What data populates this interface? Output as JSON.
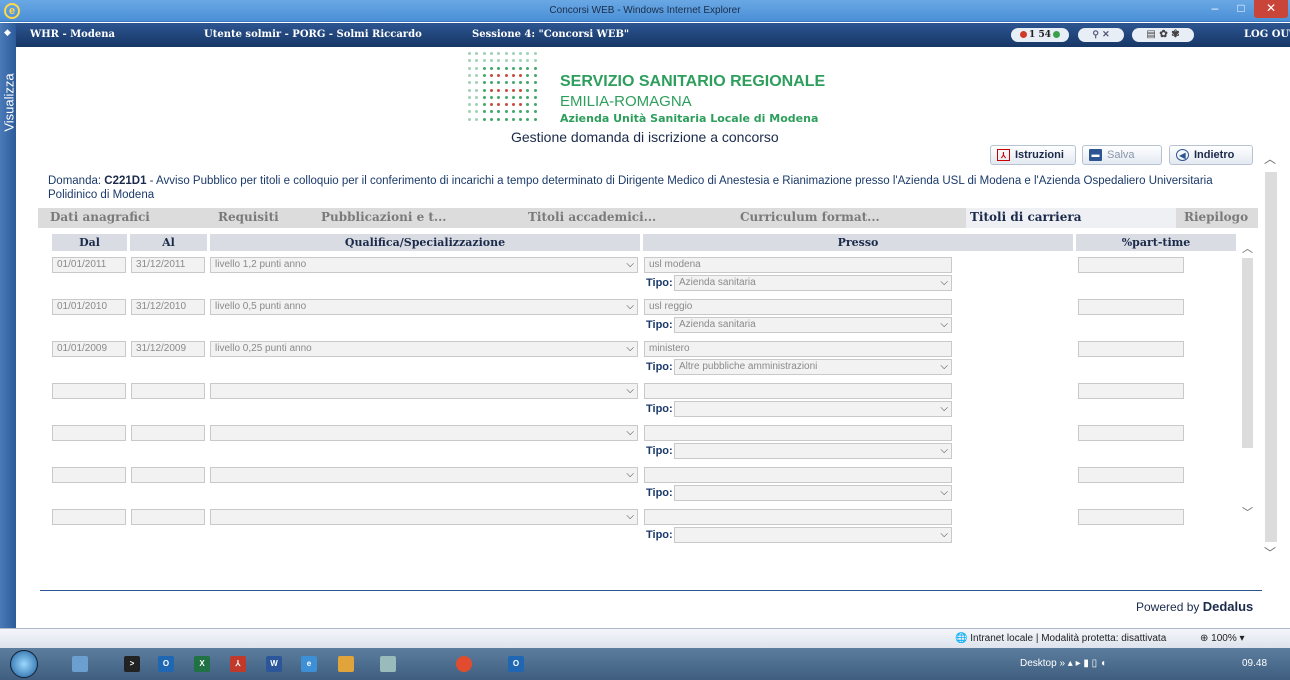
{
  "window": {
    "title": "Concorsi WEB - Windows Internet Explorer",
    "minimize": "–",
    "maximize": "□",
    "close": "✕"
  },
  "appbar": {
    "brand": "WHR - Modena",
    "user": "Utente solmir - PORG - Solmi Riccardo",
    "session": "Sessione 4: \"Concorsi WEB\"",
    "count_left": "1",
    "count_right": "54",
    "logout": "LOG OUT"
  },
  "sidebar": {
    "label": "Visualizza"
  },
  "header": {
    "line1": "SERVIZIO SANITARIO REGIONALE",
    "line2": "EMILIA-ROMAGNA",
    "line3": "Azienda Unità Sanitaria Locale di Modena",
    "subtitle": "Gestione domanda di iscrizione a concorso"
  },
  "actions": {
    "istruzioni": "Istruzioni",
    "salva": "Salva",
    "indietro": "Indietro"
  },
  "domanda": {
    "prefix": "Domanda: ",
    "code": "C221D1",
    "text": " - Avviso Pubblico per titoli e colloquio per il conferimento di incarichi a tempo determinato di Dirigente Medico di Anestesia e Rianimazione presso l'Azienda USL di Modena e l'Azienda Ospedaliero Universitaria Polidinico di Modena"
  },
  "tabs": [
    {
      "label": "Dati anagrafici"
    },
    {
      "label": "Requisiti"
    },
    {
      "label": "Pubblicazioni e t..."
    },
    {
      "label": "Titoli accademici..."
    },
    {
      "label": "Curriculum format..."
    },
    {
      "label": "Titoli di carriera"
    },
    {
      "label": "Riepilogo"
    }
  ],
  "grid": {
    "headers": {
      "dal": "Dal",
      "al": "Al",
      "qualifica": "Qualifica/Specializzazione",
      "presso": "Presso",
      "parttime": "%part-time"
    },
    "tipo_label": "Tipo:",
    "rows": [
      {
        "dal": "01/01/2011",
        "al": "31/12/2011",
        "qualifica": "livello 1,2 punti anno",
        "presso": "usl modena",
        "tipo": "Azienda sanitaria",
        "parttime": ""
      },
      {
        "dal": "01/01/2010",
        "al": "31/12/2010",
        "qualifica": "livello 0,5 punti anno",
        "presso": "usl reggio",
        "tipo": "Azienda sanitaria",
        "parttime": ""
      },
      {
        "dal": "01/01/2009",
        "al": "31/12/2009",
        "qualifica": "livello 0,25 punti anno",
        "presso": "ministero",
        "tipo": "Altre pubbliche amministrazioni",
        "parttime": ""
      },
      {
        "dal": "",
        "al": "",
        "qualifica": "",
        "presso": "",
        "tipo": "",
        "parttime": ""
      },
      {
        "dal": "",
        "al": "",
        "qualifica": "",
        "presso": "",
        "tipo": "",
        "parttime": ""
      },
      {
        "dal": "",
        "al": "",
        "qualifica": "",
        "presso": "",
        "tipo": "",
        "parttime": ""
      },
      {
        "dal": "",
        "al": "",
        "qualifica": "",
        "presso": "",
        "tipo": "",
        "parttime": ""
      }
    ]
  },
  "footer": {
    "powered_prefix": "Powered by ",
    "powered_brand": "Dedalus"
  },
  "statusbar": {
    "zone": "Intranet locale | Modalità protetta: disattivata",
    "zoom": "100%"
  },
  "taskbar": {
    "desktop": "Desktop",
    "clock": "09.48"
  },
  "colors": {
    "brand_blue": "#2c5591",
    "logo_green": "#2d9e5c",
    "logo_red": "#c0392b"
  }
}
